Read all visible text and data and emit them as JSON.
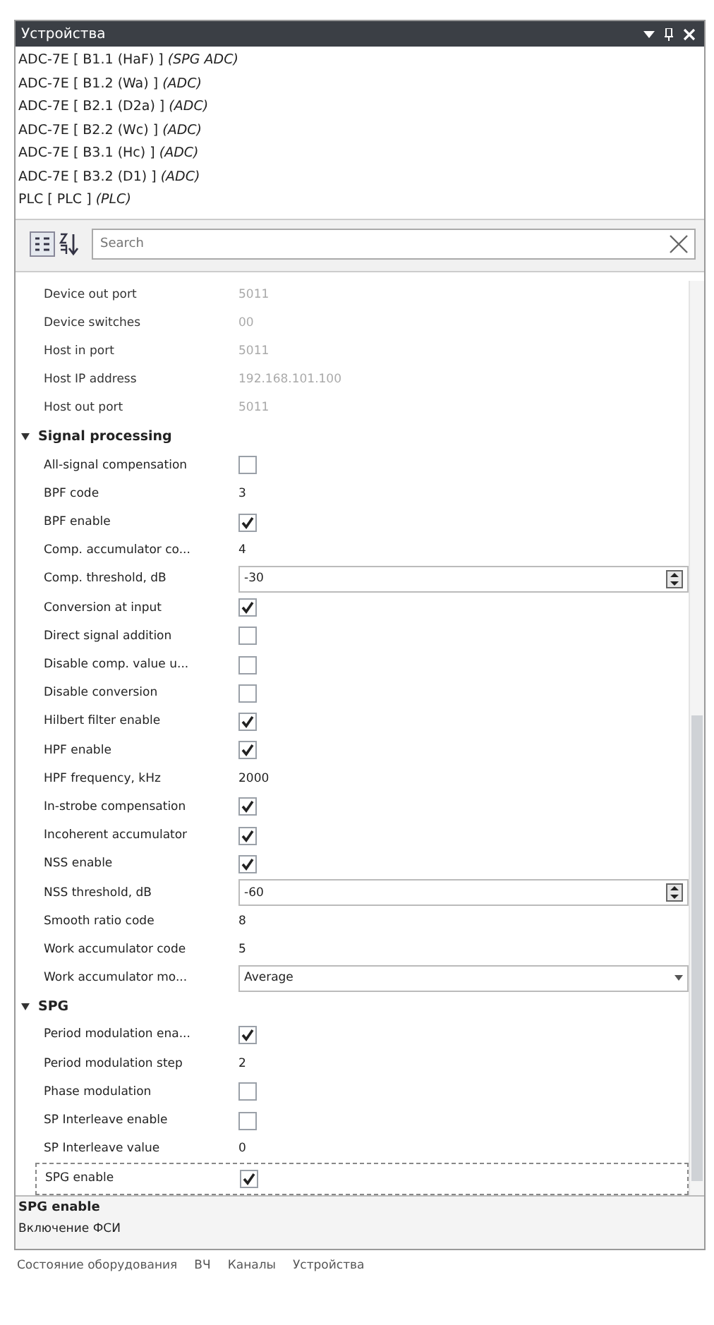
{
  "window": {
    "title": "Устройства"
  },
  "devices": [
    {
      "name": "ADC-7E [ B1.1 (HaF) ]",
      "type": "(SPG ADC)"
    },
    {
      "name": "ADC-7E [ B1.2 (Wa) ]",
      "type": "(ADC)"
    },
    {
      "name": "ADC-7E [ B2.1 (D2a) ]",
      "type": "(ADC)"
    },
    {
      "name": "ADC-7E [ B2.2 (Wc) ]",
      "type": "(ADC)"
    },
    {
      "name": "ADC-7E [ B3.1 (Hc) ]",
      "type": "(ADC)"
    },
    {
      "name": "ADC-7E [ B3.2 (D1) ]",
      "type": "(ADC)"
    },
    {
      "name": "PLC [ PLC ]",
      "type": "(PLC)"
    }
  ],
  "search": {
    "placeholder": "Search"
  },
  "properties": [
    {
      "kind": "text",
      "label": "Device out port",
      "value": "5011",
      "disabled": true,
      "selected": false
    },
    {
      "kind": "text",
      "label": "Device switches",
      "value": "00",
      "disabled": true,
      "selected": false
    },
    {
      "kind": "text",
      "label": "Host in port",
      "value": "5011",
      "disabled": true,
      "selected": false
    },
    {
      "kind": "text",
      "label": "Host IP address",
      "value": "192.168.101.100",
      "disabled": true,
      "selected": false
    },
    {
      "kind": "text",
      "label": "Host out port",
      "value": "5011",
      "disabled": true,
      "selected": false
    },
    {
      "kind": "category",
      "label": "Signal processing",
      "expanded": true
    },
    {
      "kind": "check",
      "label": "All-signal compensation",
      "checked": false,
      "disabled": false,
      "selected": false
    },
    {
      "kind": "text",
      "label": "BPF code",
      "value": "3",
      "disabled": false,
      "selected": false
    },
    {
      "kind": "check",
      "label": "BPF enable",
      "checked": true,
      "disabled": false,
      "selected": false
    },
    {
      "kind": "text",
      "label": "Comp. accumulator co...",
      "value": "4",
      "disabled": false,
      "selected": false
    },
    {
      "kind": "spin",
      "label": "Comp. threshold, dB",
      "value": "-30",
      "disabled": false,
      "selected": false
    },
    {
      "kind": "check",
      "label": "Conversion at input",
      "checked": true,
      "disabled": false,
      "selected": false
    },
    {
      "kind": "check",
      "label": "Direct signal addition",
      "checked": false,
      "disabled": false,
      "selected": false
    },
    {
      "kind": "check",
      "label": "Disable comp. value u...",
      "checked": false,
      "disabled": false,
      "selected": false
    },
    {
      "kind": "check",
      "label": "Disable conversion",
      "checked": false,
      "disabled": false,
      "selected": false
    },
    {
      "kind": "check",
      "label": "Hilbert filter enable",
      "checked": true,
      "disabled": false,
      "selected": false
    },
    {
      "kind": "check",
      "label": "HPF enable",
      "checked": true,
      "disabled": false,
      "selected": false
    },
    {
      "kind": "text",
      "label": "HPF frequency, kHz",
      "value": "2000",
      "disabled": false,
      "selected": false
    },
    {
      "kind": "check",
      "label": "In-strobe compensation",
      "checked": true,
      "disabled": false,
      "selected": false
    },
    {
      "kind": "check",
      "label": "Incoherent accumulator",
      "checked": true,
      "disabled": false,
      "selected": false
    },
    {
      "kind": "check",
      "label": "NSS enable",
      "checked": true,
      "disabled": false,
      "selected": false
    },
    {
      "kind": "spin",
      "label": "NSS threshold, dB",
      "value": "-60",
      "disabled": false,
      "selected": false
    },
    {
      "kind": "text",
      "label": "Smooth ratio code",
      "value": "8",
      "disabled": false,
      "selected": false
    },
    {
      "kind": "text",
      "label": "Work accumulator code",
      "value": "5",
      "disabled": false,
      "selected": false
    },
    {
      "kind": "dropdown",
      "label": "Work accumulator mo...",
      "value": "Average",
      "disabled": false,
      "selected": false
    },
    {
      "kind": "category",
      "label": "SPG",
      "expanded": true
    },
    {
      "kind": "check",
      "label": "Period modulation ena...",
      "checked": true,
      "disabled": false,
      "selected": false
    },
    {
      "kind": "text",
      "label": "Period modulation step",
      "value": "2",
      "disabled": false,
      "selected": false
    },
    {
      "kind": "check",
      "label": "Phase modulation",
      "checked": false,
      "disabled": false,
      "selected": false
    },
    {
      "kind": "check",
      "label": "SP Interleave enable",
      "checked": false,
      "disabled": false,
      "selected": false
    },
    {
      "kind": "text",
      "label": "SP Interleave value",
      "value": "0",
      "disabled": false,
      "selected": false
    },
    {
      "kind": "check",
      "label": "SPG enable",
      "checked": true,
      "disabled": false,
      "selected": true
    }
  ],
  "description": {
    "title": "SPG enable",
    "text": "Включение ФСИ"
  },
  "bottom_tabs": [
    {
      "label": "Состояние оборудования"
    },
    {
      "label": "ВЧ"
    },
    {
      "label": "Каналы"
    },
    {
      "label": "Устройства"
    }
  ]
}
